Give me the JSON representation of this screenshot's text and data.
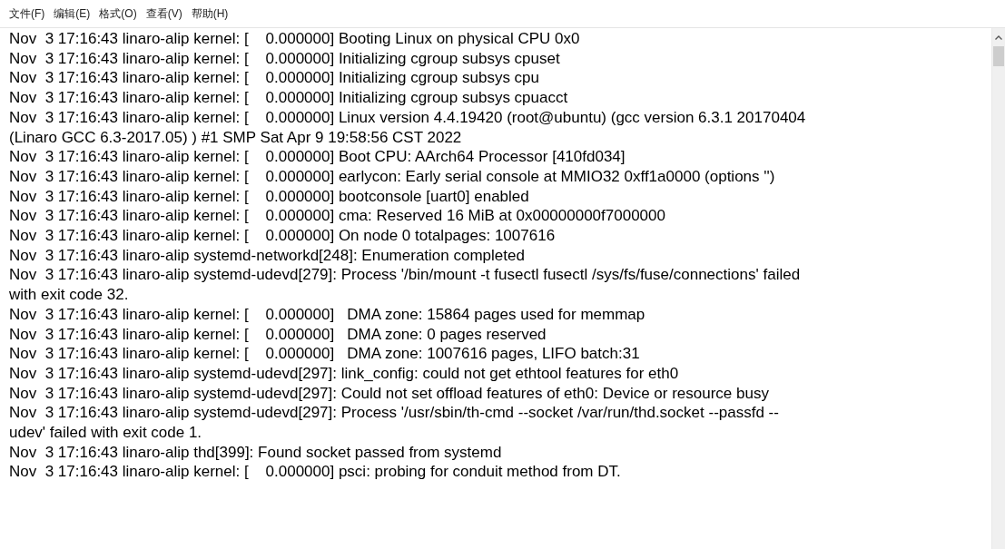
{
  "menu": [
    {
      "label": "文件(F)"
    },
    {
      "label": "编辑(E)"
    },
    {
      "label": "格式(O)"
    },
    {
      "label": "查看(V)"
    },
    {
      "label": "帮助(H)"
    }
  ],
  "lines": [
    "Nov  3 17:16:43 linaro-alip kernel: [    0.000000] Booting Linux on physical CPU 0x0",
    "Nov  3 17:16:43 linaro-alip kernel: [    0.000000] Initializing cgroup subsys cpuset",
    "Nov  3 17:16:43 linaro-alip kernel: [    0.000000] Initializing cgroup subsys cpu",
    "Nov  3 17:16:43 linaro-alip kernel: [    0.000000] Initializing cgroup subsys cpuacct",
    "Nov  3 17:16:43 linaro-alip kernel: [    0.000000] Linux version 4.4.19420 (root@ubuntu) (gcc version 6.3.1 20170404",
    "(Linaro GCC 6.3-2017.05) ) #1 SMP Sat Apr 9 19:58:56 CST 2022",
    "Nov  3 17:16:43 linaro-alip kernel: [    0.000000] Boot CPU: AArch64 Processor [410fd034]",
    "Nov  3 17:16:43 linaro-alip kernel: [    0.000000] earlycon: Early serial console at MMIO32 0xff1a0000 (options '')",
    "Nov  3 17:16:43 linaro-alip kernel: [    0.000000] bootconsole [uart0] enabled",
    "Nov  3 17:16:43 linaro-alip kernel: [    0.000000] cma: Reserved 16 MiB at 0x00000000f7000000",
    "Nov  3 17:16:43 linaro-alip kernel: [    0.000000] On node 0 totalpages: 1007616",
    "Nov  3 17:16:43 linaro-alip systemd-networkd[248]: Enumeration completed",
    "Nov  3 17:16:43 linaro-alip systemd-udevd[279]: Process '/bin/mount -t fusectl fusectl /sys/fs/fuse/connections' failed",
    "with exit code 32.",
    "Nov  3 17:16:43 linaro-alip kernel: [    0.000000]   DMA zone: 15864 pages used for memmap",
    "Nov  3 17:16:43 linaro-alip kernel: [    0.000000]   DMA zone: 0 pages reserved",
    "Nov  3 17:16:43 linaro-alip kernel: [    0.000000]   DMA zone: 1007616 pages, LIFO batch:31",
    "Nov  3 17:16:43 linaro-alip systemd-udevd[297]: link_config: could not get ethtool features for eth0",
    "Nov  3 17:16:43 linaro-alip systemd-udevd[297]: Could not set offload features of eth0: Device or resource busy",
    "Nov  3 17:16:43 linaro-alip systemd-udevd[297]: Process '/usr/sbin/th-cmd --socket /var/run/thd.socket --passfd --",
    "udev' failed with exit code 1.",
    "Nov  3 17:16:43 linaro-alip thd[399]: Found socket passed from systemd",
    "Nov  3 17:16:43 linaro-alip kernel: [    0.000000] psci: probing for conduit method from DT."
  ]
}
